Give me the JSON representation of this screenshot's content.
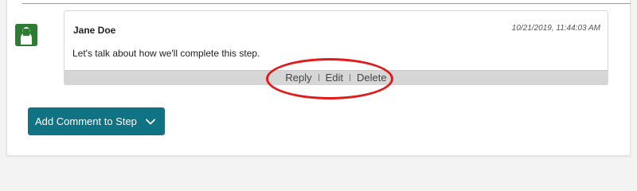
{
  "comment": {
    "author": "Jane Doe",
    "timestamp": "10/21/2019, 11:44:03 AM",
    "text": "Let's talk about how we'll complete this step.",
    "actions": [
      "Reply",
      "Edit",
      "Delete"
    ]
  },
  "add_comment": {
    "label": "Add Comment to Step",
    "icon": "chevron-down-icon"
  },
  "colors": {
    "avatar": "#2e7d32",
    "button": "#0f7384",
    "highlight": "#e01b1b",
    "action_bar": "#d6d6d6"
  }
}
